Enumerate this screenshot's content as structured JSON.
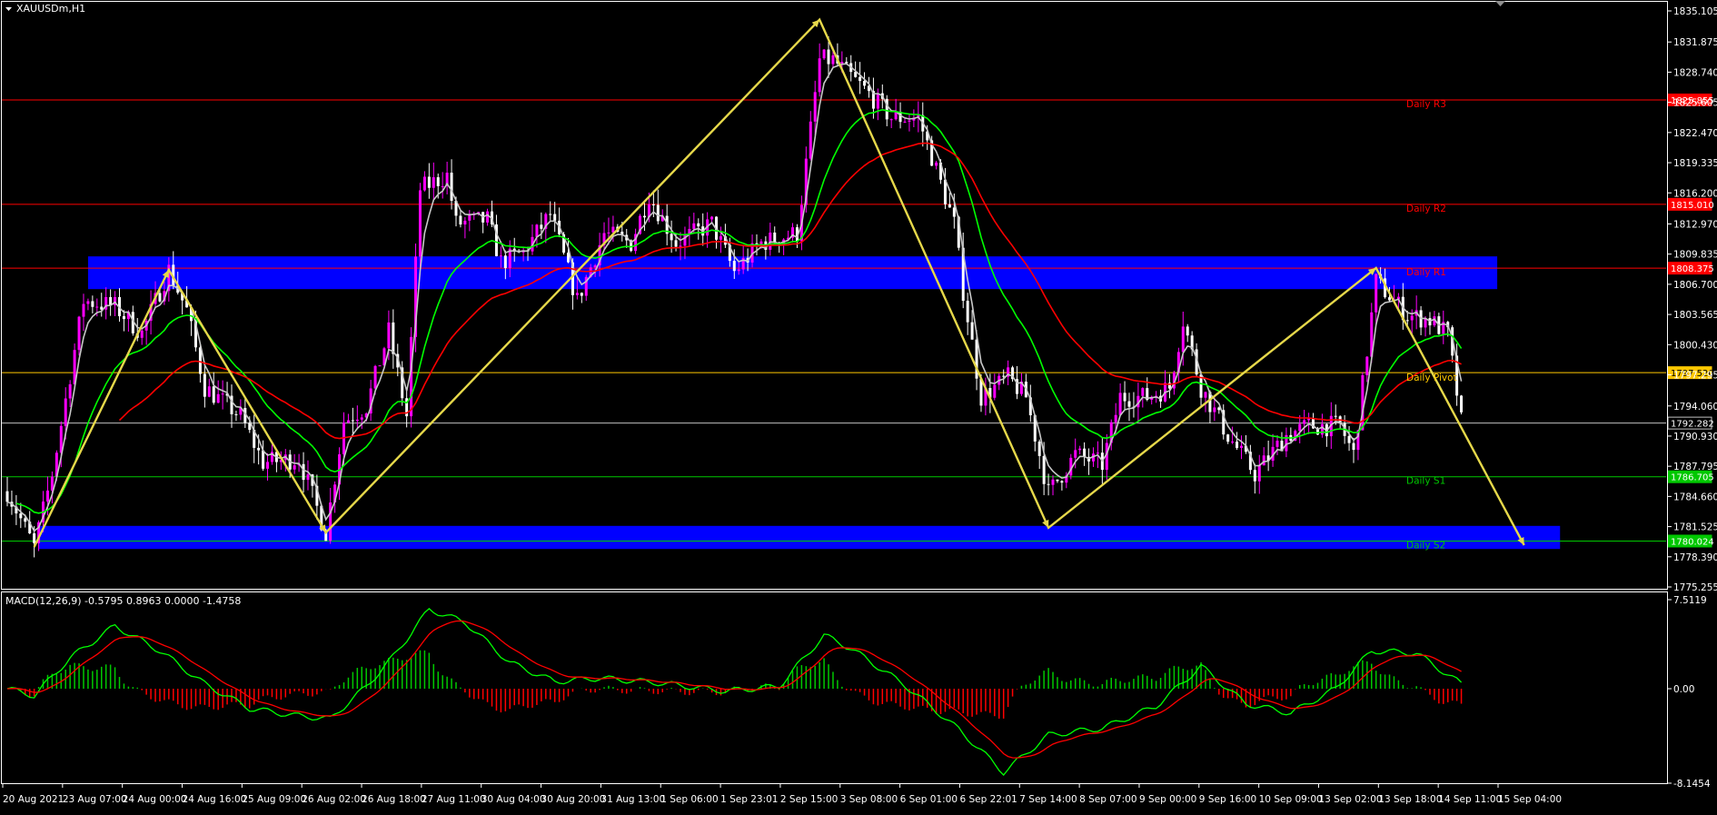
{
  "chart_data": {
    "type": "candlestick",
    "symbol": "XAUUSDm,H1",
    "timeframe": "H1",
    "colors": {
      "background": "#000000",
      "bull_candle": "#ff00ff",
      "bear_candle": "#ffffff",
      "ma_fast": "#c8c8c8",
      "ma_mid": "#00ff00",
      "ma_slow": "#ff0000",
      "zigzag": "#e6d84a",
      "zone": "#0000ff",
      "resistance": "#ff0000",
      "pivot": "#ffc800",
      "support": "#00c800",
      "macd_line": "#00ff00",
      "signal_line": "#ff0000"
    },
    "price_axis": {
      "ylim": [
        1775.255,
        1835.105
      ],
      "ticks": [
        "1835.105",
        "1831.875",
        "1828.740",
        "1825.605",
        "1822.470",
        "1819.335",
        "1816.200",
        "1812.970",
        "1809.835",
        "1806.700",
        "1803.565",
        "1800.430",
        "1797.295",
        "1794.060",
        "1790.930",
        "1787.795",
        "1784.660",
        "1781.525",
        "1778.390",
        "1775.255"
      ]
    },
    "time_axis": {
      "labels": [
        "20 Aug 2021",
        "23 Aug 07:00",
        "24 Aug 00:00",
        "24 Aug 16:00",
        "25 Aug 09:00",
        "26 Aug 02:00",
        "26 Aug 18:00",
        "27 Aug 11:00",
        "30 Aug 04:00",
        "30 Aug 20:00",
        "31 Aug 13:00",
        "1 Sep 06:00",
        "1 Sep 23:01",
        "2 Sep 15:00",
        "3 Sep 08:00",
        "6 Sep 01:00",
        "6 Sep 22:01",
        "7 Sep 14:00",
        "8 Sep 07:00",
        "9 Sep 00:00",
        "9 Sep 16:00",
        "10 Sep 09:00",
        "13 Sep 02:00",
        "13 Sep 18:00",
        "14 Sep 11:00",
        "15 Sep 04:00"
      ]
    },
    "levels": [
      {
        "name": "Daily R3",
        "price": 1825.855,
        "label": "1825.855",
        "kind": "resistance"
      },
      {
        "name": "Daily R2",
        "price": 1815.01,
        "label": "1815.010",
        "kind": "resistance"
      },
      {
        "name": "Daily R1",
        "price": 1808.375,
        "label": "1808.375",
        "kind": "resistance"
      },
      {
        "name": "Daily Pivot",
        "price": 1797.52,
        "label": "1797.520",
        "kind": "pivot"
      },
      {
        "name": "",
        "price": 1792.282,
        "label": "1792.282",
        "kind": "current"
      },
      {
        "name": "Daily S1",
        "price": 1786.705,
        "label": "1786.705",
        "kind": "support"
      },
      {
        "name": "Daily S2",
        "price": 1780.024,
        "label": "1780.024",
        "kind": "support"
      }
    ],
    "zones": [
      {
        "from_bar": 18,
        "to_bar": 332,
        "low": 1806.2,
        "high": 1809.6
      },
      {
        "from_bar": 7,
        "to_bar": 346,
        "low": 1779.2,
        "high": 1781.6
      }
    ],
    "zigzag": [
      {
        "bar": 6,
        "price": 1779.4
      },
      {
        "bar": 36,
        "price": 1808.2
      },
      {
        "bar": 71,
        "price": 1780.9
      },
      {
        "bar": 181,
        "price": 1834.2
      },
      {
        "bar": 232,
        "price": 1781.4
      },
      {
        "bar": 305,
        "price": 1808.4
      },
      {
        "bar": 338,
        "price": 1779.6
      }
    ],
    "candles": {
      "count": 325,
      "anchors": [
        [
          0,
          1785.2
        ],
        [
          6,
          1779.4
        ],
        [
          10,
          1787.0
        ],
        [
          17,
          1805.0
        ],
        [
          24,
          1804.4
        ],
        [
          30,
          1801.6
        ],
        [
          36,
          1808.2
        ],
        [
          40,
          1804.0
        ],
        [
          44,
          1796.0
        ],
        [
          52,
          1793.0
        ],
        [
          57,
          1788.2
        ],
        [
          65,
          1788.6
        ],
        [
          71,
          1780.9
        ],
        [
          75,
          1792.5
        ],
        [
          80,
          1794.0
        ],
        [
          85,
          1801.8
        ],
        [
          89,
          1793.0
        ],
        [
          92,
          1816.6
        ],
        [
          98,
          1818.0
        ],
        [
          100,
          1813.0
        ],
        [
          107,
          1813.4
        ],
        [
          110,
          1809.0
        ],
        [
          115,
          1810.0
        ],
        [
          121,
          1814.0
        ],
        [
          127,
          1805.0
        ],
        [
          133,
          1812.0
        ],
        [
          139,
          1811.0
        ],
        [
          143,
          1816.0
        ],
        [
          149,
          1811.0
        ],
        [
          157,
          1813.0
        ],
        [
          162,
          1808.0
        ],
        [
          168,
          1811.0
        ],
        [
          176,
          1812.0
        ],
        [
          181,
          1830.0
        ],
        [
          184,
          1830.0
        ],
        [
          192,
          1826.5
        ],
        [
          197,
          1824.0
        ],
        [
          203,
          1824.0
        ],
        [
          206,
          1820.0
        ],
        [
          211,
          1813.0
        ],
        [
          213,
          1806.0
        ],
        [
          217,
          1795.0
        ],
        [
          223,
          1797.0
        ],
        [
          227,
          1795.0
        ],
        [
          232,
          1785.0
        ],
        [
          238,
          1789.0
        ],
        [
          244,
          1788.0
        ],
        [
          248,
          1795.0
        ],
        [
          254,
          1795.0
        ],
        [
          259,
          1796.0
        ],
        [
          262,
          1803.0
        ],
        [
          266,
          1796.0
        ],
        [
          272,
          1791.0
        ],
        [
          278,
          1787.0
        ],
        [
          285,
          1791.0
        ],
        [
          290,
          1792.0
        ],
        [
          297,
          1792.0
        ],
        [
          300,
          1789.0
        ],
        [
          305,
          1807.0
        ],
        [
          312,
          1803.5
        ],
        [
          317,
          1803.0
        ],
        [
          321,
          1801.5
        ],
        [
          324,
          1792.4
        ]
      ]
    },
    "macd": {
      "label": "MACD(12,26,9) -0.5795 0.8963 0.0000 -1.4758",
      "ylim": [
        -8.1454,
        7.5119
      ],
      "ticks": [
        "7.5119",
        "0.00",
        "-8.1454"
      ],
      "anchors": [
        [
          0,
          0.0
        ],
        [
          6,
          -0.6
        ],
        [
          14,
          2.6
        ],
        [
          24,
          5.3
        ],
        [
          34,
          3.2
        ],
        [
          44,
          0.4
        ],
        [
          54,
          -1.7
        ],
        [
          64,
          -2.3
        ],
        [
          72,
          -2.6
        ],
        [
          80,
          0.2
        ],
        [
          86,
          2.7
        ],
        [
          94,
          6.7
        ],
        [
          102,
          5.6
        ],
        [
          112,
          2.2
        ],
        [
          122,
          0.6
        ],
        [
          132,
          0.9
        ],
        [
          145,
          0.5
        ],
        [
          160,
          -0.2
        ],
        [
          172,
          0.2
        ],
        [
          182,
          4.5
        ],
        [
          188,
          3.4
        ],
        [
          200,
          0.3
        ],
        [
          212,
          -3.5
        ],
        [
          222,
          -7.2
        ],
        [
          232,
          -4.0
        ],
        [
          244,
          -3.4
        ],
        [
          256,
          -1.5
        ],
        [
          266,
          1.9
        ],
        [
          276,
          -1.3
        ],
        [
          286,
          -2.1
        ],
        [
          296,
          0.0
        ],
        [
          304,
          3.2
        ],
        [
          314,
          3.0
        ],
        [
          324,
          0.4
        ]
      ]
    }
  }
}
